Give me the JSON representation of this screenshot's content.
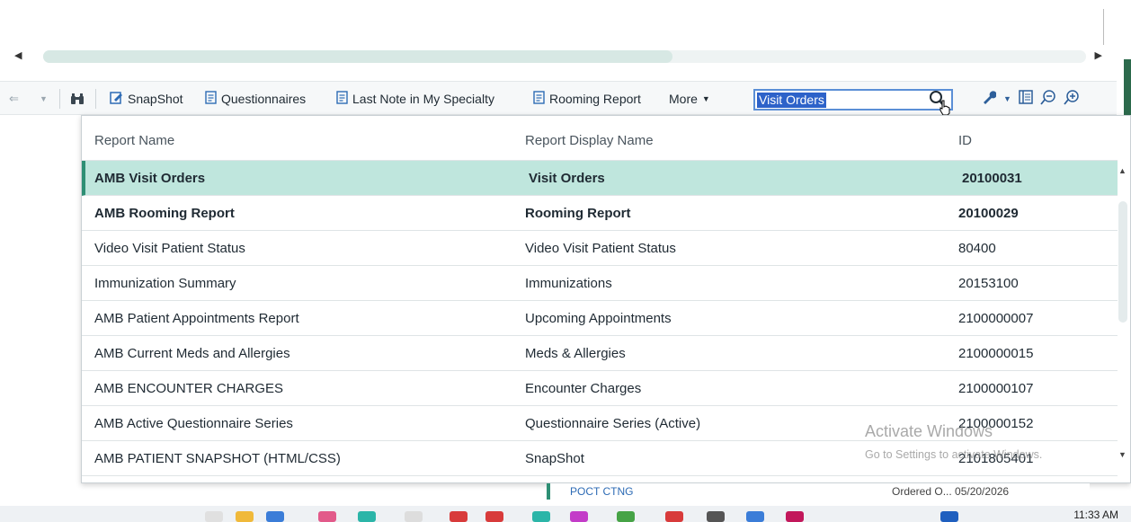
{
  "toolbar": {
    "snapshot": "SnapShot",
    "questionnaires": "Questionnaires",
    "last_note": "Last Note in My Specialty",
    "rooming_report": "Rooming Report",
    "more": "More",
    "search_value": "Visit Orders"
  },
  "table": {
    "headers": {
      "report_name": "Report Name",
      "display_name": "Report Display Name",
      "id": "ID"
    },
    "rows": [
      {
        "name": "AMB Visit Orders",
        "display": "Visit Orders",
        "id": "20100031"
      },
      {
        "name": "AMB Rooming Report",
        "display": "Rooming Report",
        "id": "20100029"
      },
      {
        "name": "Video Visit Patient Status",
        "display": "Video Visit Patient Status",
        "id": "80400"
      },
      {
        "name": "Immunization Summary",
        "display": "Immunizations",
        "id": "20153100"
      },
      {
        "name": "AMB Patient Appointments Report",
        "display": "Upcoming Appointments",
        "id": "2100000007"
      },
      {
        "name": "AMB Current Meds and Allergies",
        "display": "Meds & Allergies",
        "id": "2100000015"
      },
      {
        "name": "AMB ENCOUNTER CHARGES",
        "display": "Encounter Charges",
        "id": "2100000107"
      },
      {
        "name": "AMB Active Questionnaire Series",
        "display": "Questionnaire Series (Active)",
        "id": "2100000152"
      },
      {
        "name": "AMB PATIENT SNAPSHOT (HTML/CSS)",
        "display": "SnapShot",
        "id": "2101805401"
      }
    ]
  },
  "watermark": {
    "line1": "Activate Windows",
    "line2": "Go to Settings to activate Windows."
  },
  "behind": {
    "text1": "POCT CTNG",
    "text2": "Ordered O... 05/20/2026"
  },
  "taskbar": {
    "time": "11:33 AM"
  },
  "colors": {
    "selected_row": "#bfe6dd",
    "accent_green": "#2e8f74",
    "search_highlight": "#2d62c9"
  }
}
